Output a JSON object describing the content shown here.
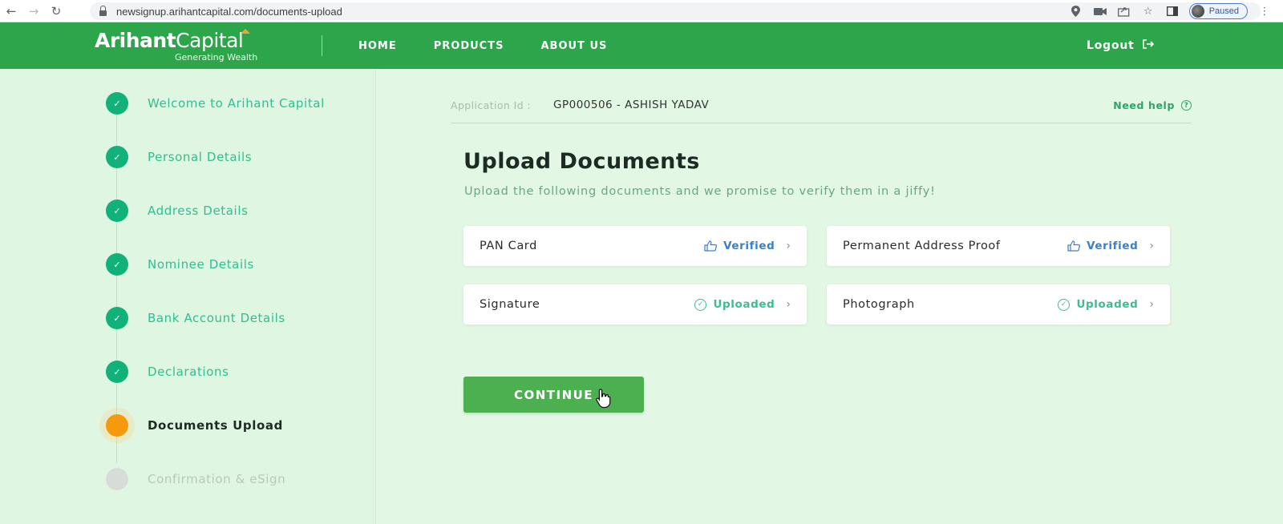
{
  "browser": {
    "url": "newsignup.arihantcapital.com/documents-upload",
    "profile_status": "Paused",
    "icons": [
      "back-arrow-icon",
      "forward-arrow-icon",
      "reload-icon",
      "lock-icon",
      "location-icon",
      "camera-icon",
      "share-icon",
      "star-icon",
      "sidepanel-icon",
      "kebab-menu-icon"
    ]
  },
  "header": {
    "logo_bold": "Arihant",
    "logo_regular": "Capital",
    "logo_tagline": "Generating Wealth",
    "nav": [
      "HOME",
      "PRODUCTS",
      "ABOUT US"
    ],
    "logout_label": "Logout",
    "background_color": "#2ca54b"
  },
  "sidebar": {
    "steps": [
      {
        "label": "Welcome to Arihant Capital",
        "state": "done"
      },
      {
        "label": "Personal Details",
        "state": "done"
      },
      {
        "label": "Address Details",
        "state": "done"
      },
      {
        "label": "Nominee Details",
        "state": "done"
      },
      {
        "label": "Bank Account Details",
        "state": "done"
      },
      {
        "label": "Declarations",
        "state": "done"
      },
      {
        "label": "Documents Upload",
        "state": "current"
      },
      {
        "label": "Confirmation & eSign",
        "state": "pending"
      }
    ],
    "colors": {
      "done": "#10b27a",
      "current": "#f59a0f",
      "pending": "#d8dcd9"
    }
  },
  "main": {
    "application_label": "Application Id :",
    "application_value": "GP000506 - ASHISH YADAV",
    "need_help": "Need help",
    "title": "Upload Documents",
    "subtitle": "Upload the following documents and we promise to verify them in a jiffy!",
    "documents": [
      {
        "name": "PAN Card",
        "status": "Verified",
        "status_type": "verified"
      },
      {
        "name": "Permanent Address Proof",
        "status": "Verified",
        "status_type": "verified"
      },
      {
        "name": "Signature",
        "status": "Uploaded",
        "status_type": "uploaded"
      },
      {
        "name": "Photograph",
        "status": "Uploaded",
        "status_type": "uploaded"
      }
    ],
    "continue_label": "CONTINUE",
    "continue_color": "#4caf50"
  }
}
